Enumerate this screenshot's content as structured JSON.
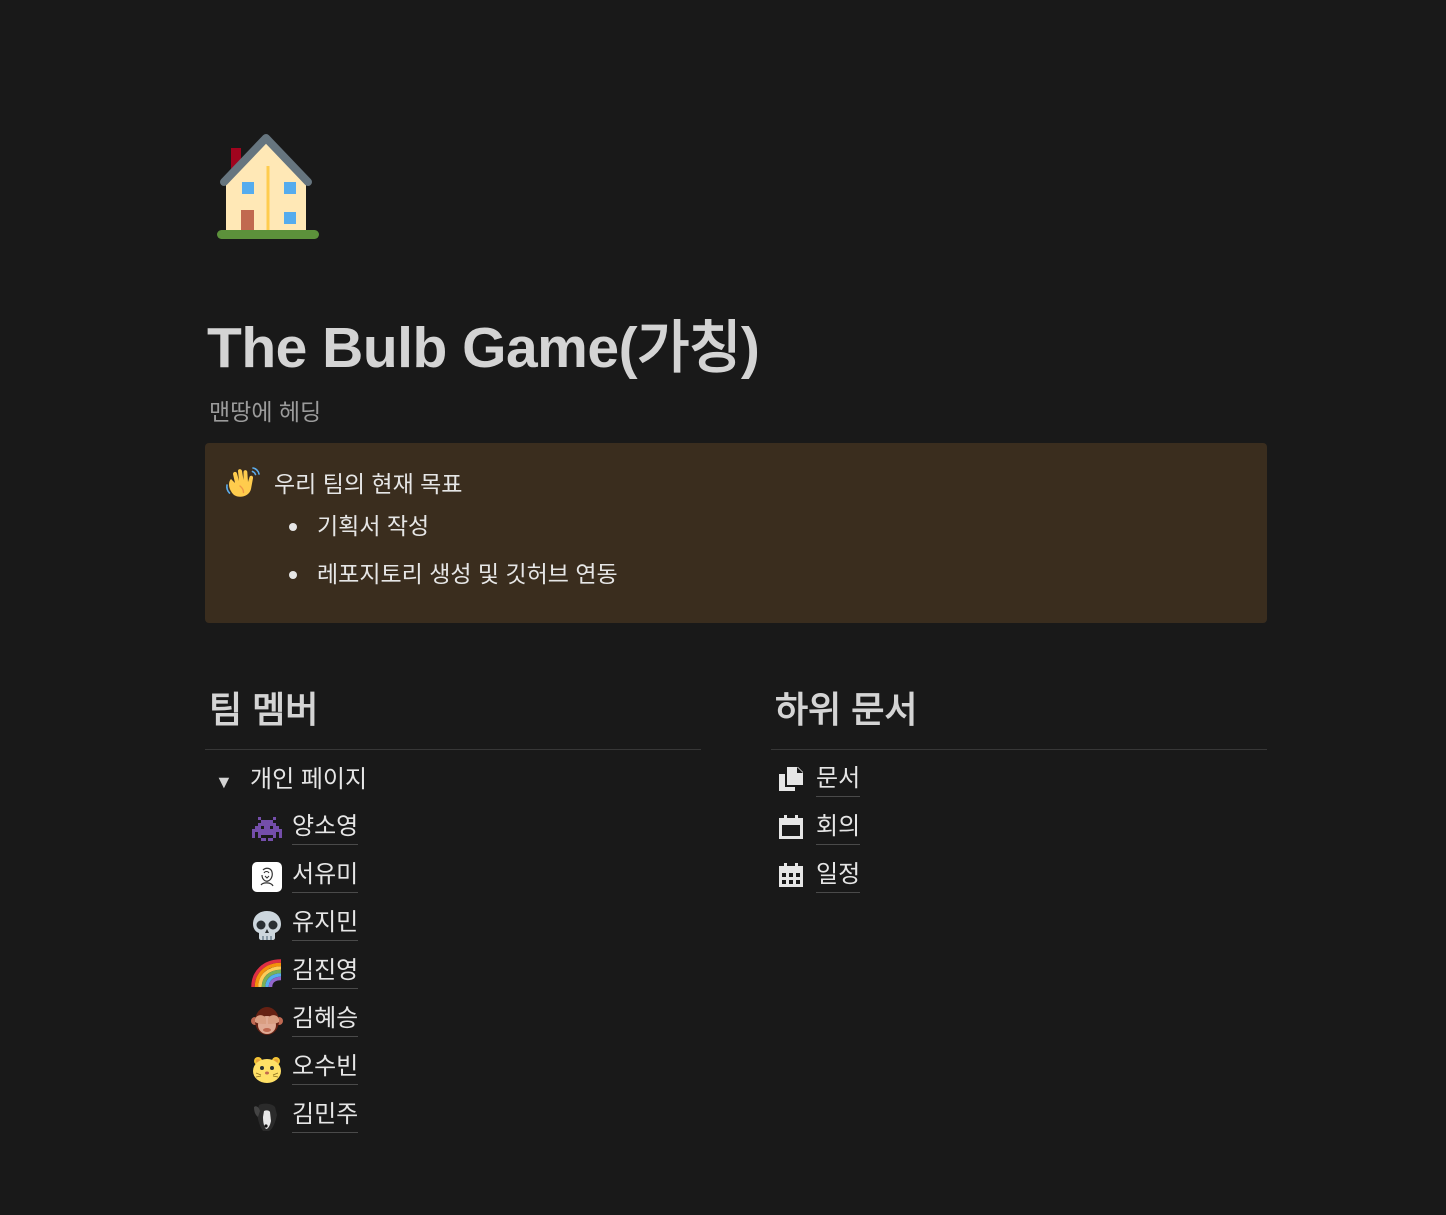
{
  "page": {
    "icon": "house-icon",
    "title": "The Bulb Game(가칭)",
    "subtitle": "맨땅에 헤딩"
  },
  "callout": {
    "icon": "waving-hand-icon",
    "title": "우리 팀의 현재 목표",
    "items": [
      "기획서 작성",
      "레포지토리 생성 및 깃허브 연동"
    ]
  },
  "team": {
    "heading": "팀 멤버",
    "toggle": {
      "arrow": "▼",
      "label": "개인 페이지"
    },
    "members": [
      {
        "name": "양소영",
        "icon": "space-invader-icon"
      },
      {
        "name": "서유미",
        "icon": "sketch-avatar-icon"
      },
      {
        "name": "유지민",
        "icon": "skull-icon"
      },
      {
        "name": "김진영",
        "icon": "rainbow-icon"
      },
      {
        "name": "김혜승",
        "icon": "see-no-evil-monkey-icon"
      },
      {
        "name": "오수빈",
        "icon": "hamster-icon"
      },
      {
        "name": "김민주",
        "icon": "dog-photo-icon"
      }
    ]
  },
  "subdocs": {
    "heading": "하위 문서",
    "items": [
      {
        "name": "문서",
        "icon": "documents-icon"
      },
      {
        "name": "회의",
        "icon": "calendar-icon"
      },
      {
        "name": "일정",
        "icon": "calendar-grid-icon"
      }
    ]
  },
  "colors": {
    "background": "#191919",
    "callout_background": "#3a2d1e",
    "text": "#d4d4d4",
    "muted_text": "#9b9b9b",
    "divider": "#373737"
  }
}
